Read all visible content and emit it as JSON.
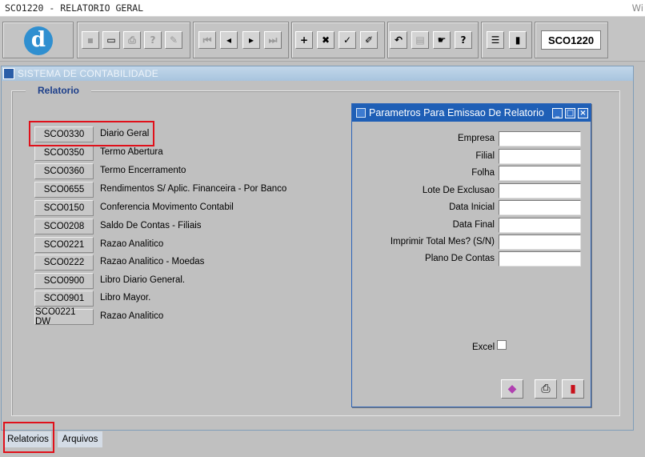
{
  "window": {
    "title": "SCO1220 - RELATORIO GERAL",
    "os_text": "Wi"
  },
  "toolbar": {
    "logo_letter": "d",
    "buttons": [
      {
        "icon": "save-icon",
        "glyph": "▪"
      },
      {
        "icon": "screen-icon",
        "glyph": "▭"
      },
      {
        "icon": "printer-icon",
        "glyph": "⎙"
      },
      {
        "icon": "query-icon",
        "glyph": "?"
      },
      {
        "icon": "spell-icon",
        "glyph": "✎"
      },
      {
        "icon": "first-record-icon",
        "glyph": "⏮"
      },
      {
        "icon": "prev-record-icon",
        "glyph": "◂"
      },
      {
        "icon": "next-record-icon",
        "glyph": "▸"
      },
      {
        "icon": "last-record-icon",
        "glyph": "⏭"
      },
      {
        "icon": "add-icon",
        "glyph": "+"
      },
      {
        "icon": "delete-icon",
        "glyph": "✖"
      },
      {
        "icon": "edit-record-icon",
        "glyph": "✓"
      },
      {
        "icon": "clear-icon",
        "glyph": "✐"
      },
      {
        "icon": "undo-icon",
        "glyph": "↶"
      },
      {
        "icon": "clipboard-icon",
        "glyph": "▤"
      },
      {
        "icon": "hand-icon",
        "glyph": "☛"
      },
      {
        "icon": "help-icon",
        "glyph": "?"
      },
      {
        "icon": "menu-icon",
        "glyph": "☰"
      },
      {
        "icon": "exit-icon",
        "glyph": "▮"
      }
    ],
    "program_code": "SCO1220"
  },
  "frame": {
    "title": "SISTEMA DE CONTABILIDADE"
  },
  "group": {
    "label": "Relatorio"
  },
  "reports": [
    {
      "code": "SCO0330",
      "label": "Diario Geral"
    },
    {
      "code": "SCO0350",
      "label": "Termo Abertura"
    },
    {
      "code": "SCO0360",
      "label": "Termo Encerramento"
    },
    {
      "code": "SCO0655",
      "label": "Rendimentos S/ Aplic. Financeira - Por Banco"
    },
    {
      "code": "SCO0150",
      "label": "Conferencia Movimento Contabil"
    },
    {
      "code": "SCO0208",
      "label": "Saldo De Contas - Filiais"
    },
    {
      "code": "SCO0221",
      "label": "Razao Analitico"
    },
    {
      "code": "SCO0222",
      "label": "Razao Analitico - Moedas"
    },
    {
      "code": "SCO0900",
      "label": "Libro Diario General."
    },
    {
      "code": "SCO0901",
      "label": "Libro Mayor."
    },
    {
      "code": "SCO0221 DW",
      "label": "Razao Analitico"
    }
  ],
  "params": {
    "title": "Parametros Para Emissao De Relatorio",
    "fields": [
      {
        "label": "Empresa",
        "value": ""
      },
      {
        "label": "Filial",
        "value": ""
      },
      {
        "label": "Folha",
        "value": ""
      },
      {
        "label": "Lote De Exclusao",
        "value": ""
      },
      {
        "label": "Data Inicial",
        "value": ""
      },
      {
        "label": "Data Final",
        "value": ""
      },
      {
        "label": "Imprimir Total Mes? (S/N)",
        "value": ""
      },
      {
        "label": "Plano De Contas",
        "value": ""
      }
    ],
    "excel_label": "Excel",
    "excel_checked": false
  },
  "tabs": [
    {
      "label": "Relatorios",
      "active": true
    },
    {
      "label": "Arquivos",
      "active": false
    }
  ]
}
